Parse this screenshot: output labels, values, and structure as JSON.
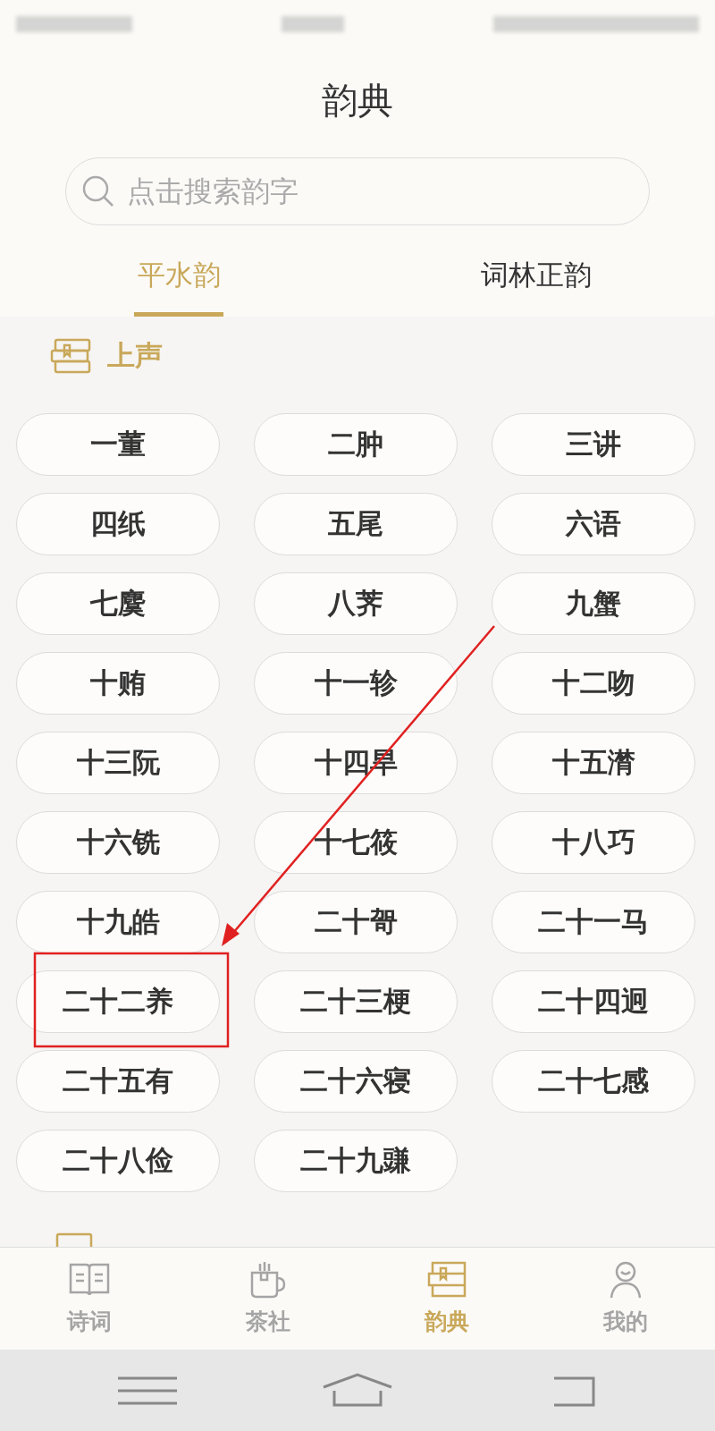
{
  "header": {
    "title": "韵典"
  },
  "search": {
    "placeholder": "点击搜索韵字"
  },
  "tabs": [
    {
      "label": "平水韵",
      "selected": true
    },
    {
      "label": "词林正韵",
      "selected": false
    }
  ],
  "section": {
    "title": "上声"
  },
  "rhymes": [
    "一董",
    "二肿",
    "三讲",
    "四纸",
    "五尾",
    "六语",
    "七麌",
    "八荠",
    "九蟹",
    "十贿",
    "十一轸",
    "十二吻",
    "十三阮",
    "十四旱",
    "十五潸",
    "十六铣",
    "十七筱",
    "十八巧",
    "十九皓",
    "二十哿",
    "二十一马",
    "二十二养",
    "二十三梗",
    "二十四迥",
    "二十五有",
    "二十六寝",
    "二十七感",
    "二十八俭",
    "二十九豏"
  ],
  "bottom_nav": [
    {
      "label": "诗词",
      "kind": "book",
      "selected": false
    },
    {
      "label": "茶社",
      "kind": "cup",
      "selected": false
    },
    {
      "label": "韵典",
      "kind": "books",
      "selected": true
    },
    {
      "label": "我的",
      "kind": "person",
      "selected": false
    }
  ]
}
